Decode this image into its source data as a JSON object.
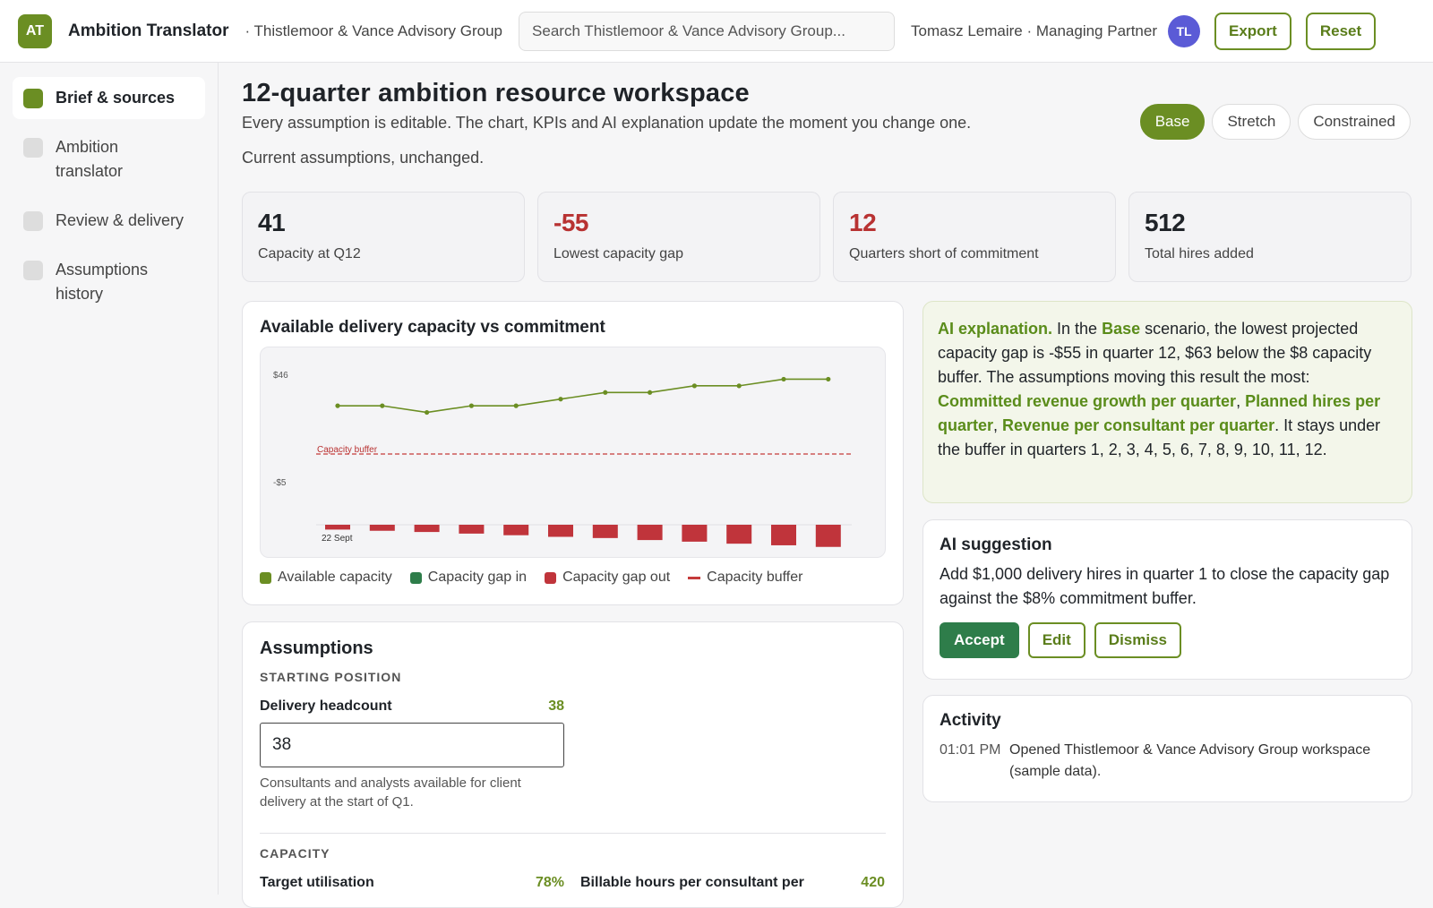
{
  "header": {
    "logo": "AT",
    "app_name": "Ambition Translator",
    "org": "· Thistlemoor & Vance Advisory Group",
    "search_placeholder": "Search Thistlemoor & Vance Advisory Group...",
    "user": "Tomasz Lemaire · Managing Partner",
    "avatar": "TL",
    "export_label": "Export",
    "reset_label": "Reset"
  },
  "sidebar": {
    "items": [
      {
        "label": "Brief & sources",
        "active": true
      },
      {
        "label": "Ambition translator",
        "active": false
      },
      {
        "label": "Review & delivery",
        "active": false
      },
      {
        "label": "Assumptions history",
        "active": false
      }
    ]
  },
  "page": {
    "title": "12-quarter ambition resource workspace",
    "subtitle": "Every assumption is editable. The chart, KPIs and AI explanation update the moment you change one.",
    "status": "Current assumptions, unchanged.",
    "scenarios": [
      "Base",
      "Stretch",
      "Constrained"
    ],
    "active_scenario": "Base"
  },
  "kpis": [
    {
      "value": "41",
      "label": "Capacity at Q12",
      "color": "#1f2328"
    },
    {
      "value": "-55",
      "label": "Lowest capacity gap",
      "color": "#b83232"
    },
    {
      "value": "12",
      "label": "Quarters short of commitment",
      "color": "#b83232"
    },
    {
      "value": "512",
      "label": "Total hires added",
      "color": "#1f2328"
    }
  ],
  "chart": {
    "title": "Available delivery capacity vs commitment",
    "y_top_label": "$46",
    "y_mid_label": "-$5",
    "buffer_label": "Capacity buffer",
    "x_label": "22 Sept",
    "legend": [
      "Available capacity",
      "Capacity gap in",
      "Capacity gap out",
      "Capacity buffer"
    ],
    "colors": {
      "capacity": "#6b8e23",
      "gap_in": "#2e7d4a",
      "gap_out": "#c0343b",
      "buffer": "#c53b3b"
    }
  },
  "chart_data": {
    "type": "line",
    "x": [
      1,
      2,
      3,
      4,
      5,
      6,
      7,
      8,
      9,
      10,
      11,
      12
    ],
    "series": [
      {
        "name": "Available capacity",
        "type": "line",
        "values": [
          38,
          38,
          37,
          38,
          38,
          39,
          40,
          40,
          41,
          41,
          42,
          42
        ]
      },
      {
        "name": "Capacity gap out",
        "type": "bar",
        "values": [
          -12,
          -15,
          -18,
          -22,
          -26,
          -30,
          -33,
          -38,
          -42,
          -47,
          -51,
          -55
        ]
      }
    ],
    "buffer": 8,
    "buffer_label": "Capacity buffer",
    "ylim": [
      -60,
      50
    ]
  },
  "assumptions": {
    "title": "Assumptions",
    "section1": "STARTING POSITION",
    "headcount_label": "Delivery headcount",
    "headcount_value": "38",
    "headcount_input": "38",
    "headcount_help": "Consultants and analysts available for client delivery at the start of Q1.",
    "section2": "CAPACITY",
    "util_label": "Target utilisation",
    "util_value": "78%",
    "hours_label": "Billable hours per consultant per",
    "hours_value": "420"
  },
  "ai": {
    "lead": "AI explanation.",
    "t1": " In the ",
    "scenario": "Base",
    "t2": " scenario, the lowest projected capacity gap is -$55 in quarter 12, $63 below the $8 capacity buffer. The assumptions moving this result the most: ",
    "d1": "Committed revenue growth per quarter",
    "c1": ", ",
    "d2": "Planned hires per quarter",
    "c2": ", ",
    "d3": "Revenue per consultant per quarter",
    "t3": ". It stays under the buffer in quarters 1, 2, 3, 4, 5, 6, 7, 8, 9, 10, 11, 12."
  },
  "suggestion": {
    "title": "AI suggestion",
    "text": "Add $1,000 delivery hires in quarter 1 to close the capacity gap against the $8% commitment buffer.",
    "accept": "Accept",
    "edit": "Edit",
    "dismiss": "Dismiss"
  },
  "activity": {
    "title": "Activity",
    "items": [
      {
        "time": "01:01 PM",
        "text": "Opened Thistlemoor & Vance Advisory Group workspace (sample data)."
      }
    ]
  }
}
